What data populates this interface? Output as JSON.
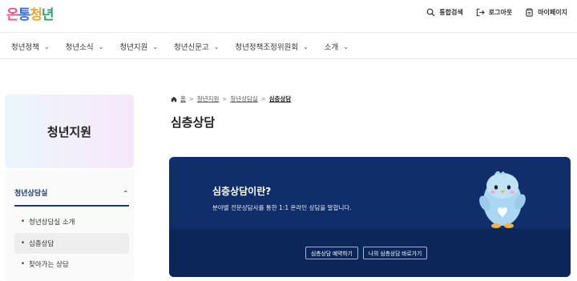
{
  "header": {
    "logo": {
      "part1": "온",
      "part2": "통",
      "part3": "청",
      "part4": "년"
    },
    "utils": [
      {
        "label": "통합검색",
        "icon": "search-icon"
      },
      {
        "label": "로그아웃",
        "icon": "logout-icon"
      },
      {
        "label": "마이페이지",
        "icon": "mypage-icon"
      }
    ]
  },
  "gnb": {
    "items": [
      {
        "label": "청년정책"
      },
      {
        "label": "청년소식"
      },
      {
        "label": "청년지원"
      },
      {
        "label": "청년신문고"
      },
      {
        "label": "청년정책조정위원회"
      },
      {
        "label": "소개"
      }
    ],
    "chevron": "⌄"
  },
  "sidebar": {
    "hero_title": "청년지원",
    "section_label": "청년상담실",
    "items": [
      {
        "label": "청년상담실 소개",
        "bullet": "•"
      },
      {
        "label": "심층상담",
        "bullet": "•"
      },
      {
        "label": "찾아가는 상담",
        "bullet": "•"
      }
    ]
  },
  "breadcrumb": {
    "home": "홈",
    "items": [
      "청년지원",
      "청년상담실"
    ],
    "current": "심층상담",
    "separator": ">"
  },
  "main": {
    "title": "심층상담",
    "banner": {
      "title": "심층상담이란?",
      "description": "분야별 전문상담사를 통한 1:1 온라인 상담을 말합니다.",
      "buttons": [
        "심층상담 예약하기",
        "나의 심층상담 바로가기"
      ]
    }
  },
  "colors": {
    "banner_bg": "#0f2e6a",
    "accent": "#1f3a6b"
  }
}
